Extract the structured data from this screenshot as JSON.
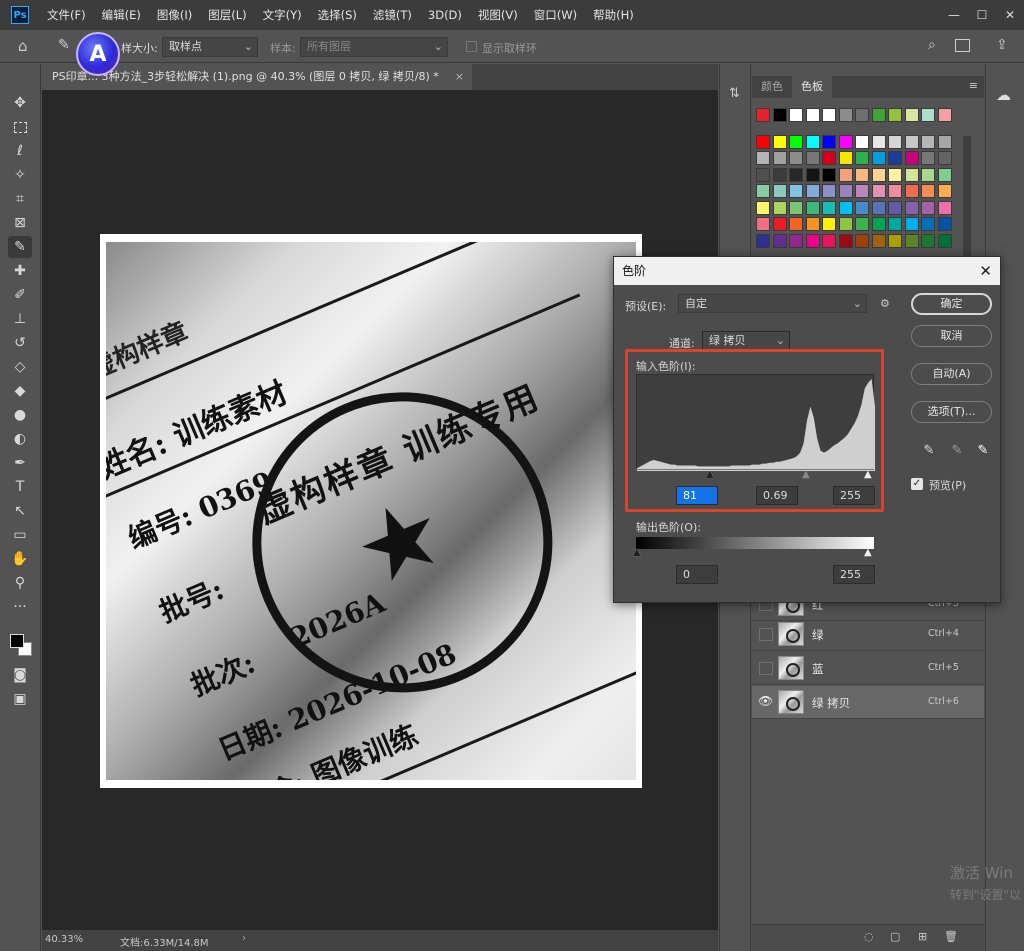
{
  "app": {
    "logo": "Ps"
  },
  "menu": [
    "文件(F)",
    "编辑(E)",
    "图像(I)",
    "图层(L)",
    "文字(Y)",
    "选择(S)",
    "滤镜(T)",
    "3D(D)",
    "视图(V)",
    "窗口(W)",
    "帮助(H)"
  ],
  "window_controls": {
    "minimize": "—",
    "restore": "☐",
    "close": "✕"
  },
  "options": {
    "sample_size_label": "样大小:",
    "sample_size_value": "取样点",
    "sample_label": "样本:",
    "sample_value": "所有图层",
    "show_ring_label": "显示取样环"
  },
  "document": {
    "tab_title": "PS印章... 3种方法_3步轻松解决 (1).png @ 40.3% (图层 0 拷贝, 绿 拷贝/8) *",
    "tab_close": "×",
    "zoom": "40.33%",
    "doc_size": "文档:6.33M/14.8M"
  },
  "image_text": {
    "header": "虚构样章",
    "name_line": "姓名: 训练素材",
    "number_line": "编号: 0369",
    "batch_label": "批号:",
    "lot_line": "批次:",
    "lot_code": "2026A",
    "date_line": "日期: 2026-10-08",
    "use_line": "用途: 图像训练",
    "stamp_top": "虚构样章 训练专用"
  },
  "swatches_panel": {
    "tab_color": "颜色",
    "tab_swatches": "色板",
    "colors": [
      "#e8202a",
      "#000000",
      "#ffffff",
      "#ffffff",
      "#ffffff",
      "#8c8c8c",
      "#6e6e6e",
      "#3fa535",
      "#93c23d",
      "#d8e8a0",
      "#a8e0c8",
      "#f4a0a0",
      "#ff0000",
      "#ffff00",
      "#00ff00",
      "#00ffff",
      "#0000ff",
      "#ff00ff",
      "#ffffff",
      "#e6e6e6",
      "#d6d6d6",
      "#c6c6c6",
      "#b6b6b6",
      "#a6a6a6",
      "#b4b4b4",
      "#a0a0a0",
      "#8c8c8c",
      "#787878",
      "#d5001c",
      "#f5e600",
      "#2bb24c",
      "#00a0e0",
      "#1e3c9a",
      "#c8007a",
      "#787878",
      "#646464",
      "#505050",
      "#3c3c3c",
      "#282828",
      "#141414",
      "#000000",
      "#f4a07a",
      "#f8b87e",
      "#fcd48c",
      "#fff1a0",
      "#d2e49a",
      "#a8d88c",
      "#7ccf8c",
      "#88cca0",
      "#8acbc0",
      "#7ec4e4",
      "#82aadc",
      "#8a90c8",
      "#9a82bc",
      "#ba86bc",
      "#e490b4",
      "#f08ca0",
      "#f26c4f",
      "#f68e56",
      "#fbad4e",
      "#fff568",
      "#acd35f",
      "#7dc573",
      "#3cb878",
      "#1cbbb4",
      "#00bff3",
      "#448ccb",
      "#5574b9",
      "#605ca8",
      "#855fa8",
      "#a763a8",
      "#f06ea9",
      "#f26d7d",
      "#ed1c24",
      "#f26522",
      "#f7941d",
      "#fff200",
      "#8dc63f",
      "#39b54a",
      "#00a651",
      "#00a99d",
      "#00aeef",
      "#0072bc",
      "#0054a6",
      "#2e3192",
      "#662d91",
      "#92278f",
      "#ec008c",
      "#ed145b",
      "#9e0b0f",
      "#a0410d",
      "#a36209",
      "#aba000",
      "#598527",
      "#1a7b30",
      "#007236"
    ]
  },
  "layers": [
    {
      "name": "红",
      "shortcut": "Ctrl+3",
      "visible": false,
      "selected": false
    },
    {
      "name": "绿",
      "shortcut": "Ctrl+4",
      "visible": false,
      "selected": false
    },
    {
      "name": "蓝",
      "shortcut": "Ctrl+5",
      "visible": false,
      "selected": false
    },
    {
      "name": "绿 拷贝",
      "shortcut": "Ctrl+6",
      "visible": true,
      "selected": true
    }
  ],
  "levels_dialog": {
    "title": "色阶",
    "close": "✕",
    "preset_label": "预设(E):",
    "preset_value": "自定",
    "channel_label": "通道:",
    "channel_value": "绿 拷贝",
    "input_label": "输入色阶(I):",
    "input_black": "81",
    "input_gamma": "0.69",
    "input_white": "255",
    "output_label": "输出色阶(O):",
    "output_black": "0",
    "output_white": "255",
    "ok": "确定",
    "cancel": "取消",
    "auto": "自动(A)",
    "options": "选项(T)...",
    "preview_label": "预览(P)",
    "preview_checked": true
  },
  "watermark": {
    "line1": "激活 Win",
    "line2": "转到\"设置\"以"
  },
  "histogram": [
    3,
    5,
    7,
    9,
    11,
    12,
    11,
    10,
    9,
    8,
    7,
    7,
    6,
    6,
    6,
    6,
    6,
    6,
    5,
    5,
    5,
    5,
    5,
    5,
    5,
    5,
    5,
    5,
    6,
    6,
    6,
    6,
    6,
    6,
    7,
    7,
    7,
    8,
    8,
    9,
    9,
    10,
    10,
    11,
    12,
    13,
    14,
    16,
    20,
    30,
    55,
    70,
    58,
    35,
    22,
    20,
    22,
    25,
    28,
    30,
    33,
    36,
    40,
    46,
    52,
    60,
    72,
    90,
    96,
    100,
    70
  ]
}
